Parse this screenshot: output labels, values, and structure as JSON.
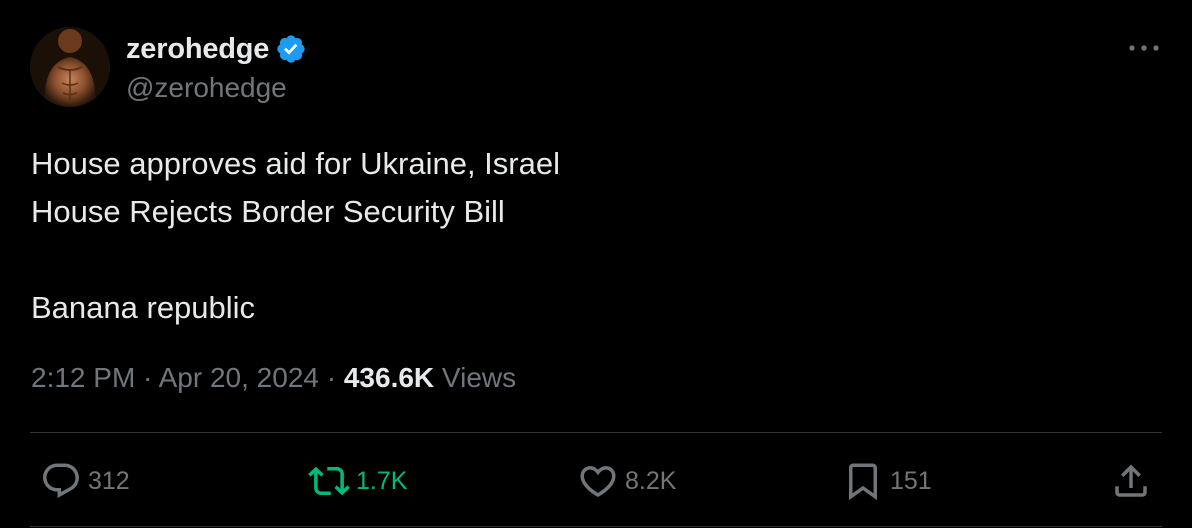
{
  "author": {
    "display_name": "zerohedge",
    "handle": "@zerohedge",
    "verified_icon": "verified-badge-icon",
    "verified_color": "#1d9bf0"
  },
  "tweet": {
    "lines": [
      "House approves aid for Ukraine, Israel",
      "House Rejects Border Security Bill",
      "",
      "Banana republic"
    ]
  },
  "meta": {
    "time": "2:12 PM",
    "separator": " · ",
    "date": "Apr 20, 2024",
    "views_count": "436.6K",
    "views_label": " Views"
  },
  "actions": {
    "replies": "312",
    "retweets": "1.7K",
    "likes": "8.2K",
    "bookmarks": "151"
  },
  "colors": {
    "background": "#000000",
    "text": "#e7e9ea",
    "muted": "#71767b",
    "retweet_green": "#00ba7c",
    "divider": "#2f3336"
  }
}
